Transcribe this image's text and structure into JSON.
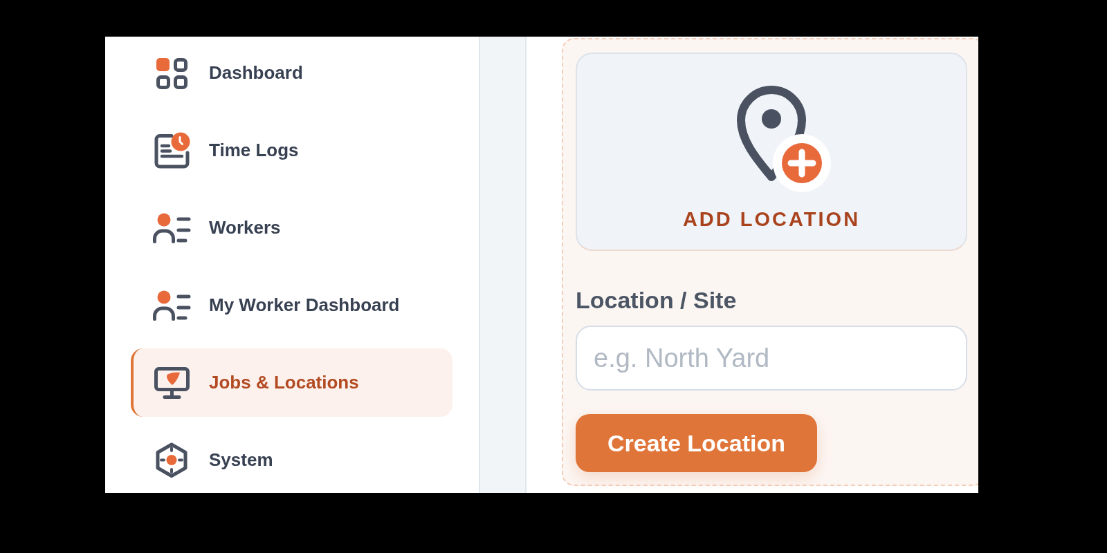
{
  "sidebar": {
    "items": [
      {
        "label": "Dashboard",
        "selected": false
      },
      {
        "label": "Time Logs",
        "selected": false
      },
      {
        "label": "Workers",
        "selected": false
      },
      {
        "label": "My Worker Dashboard",
        "selected": false
      },
      {
        "label": "Jobs & Locations",
        "selected": true
      },
      {
        "label": "System",
        "selected": false
      }
    ]
  },
  "add_location": {
    "label": "ADD LOCATION"
  },
  "location_field": {
    "label": "Location / Site",
    "placeholder": "e.g. North Yard"
  },
  "create_button": {
    "label": "Create Location"
  }
}
